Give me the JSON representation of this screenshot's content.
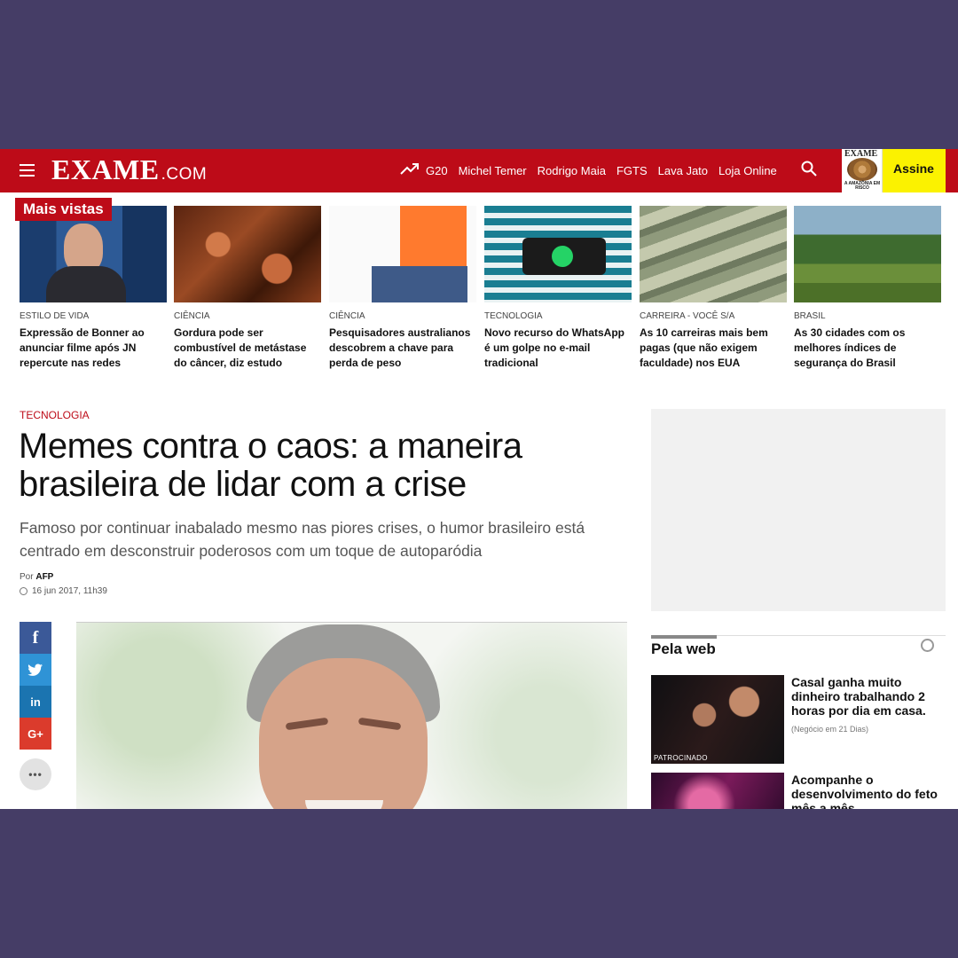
{
  "header": {
    "logo_main": "EXAME",
    "logo_suffix": ".COM",
    "nav": [
      "G20",
      "Michel Temer",
      "Rodrigo Maia",
      "FGTS",
      "Lava Jato",
      "Loja Online"
    ],
    "subscribe_label": "Assine",
    "cover_title": "EXAME",
    "cover_caption": "A AMAZÔNIA EM RISCO"
  },
  "most_viewed": {
    "label": "Mais vistas",
    "items": [
      {
        "category": "ESTILO DE VIDA",
        "title": "Expressão de Bonner ao anunciar filme após JN repercute nas redes"
      },
      {
        "category": "CIÊNCIA",
        "title": "Gordura pode ser combustível de metástase do câncer, diz estudo"
      },
      {
        "category": "CIÊNCIA",
        "title": "Pesquisadores australianos descobrem a chave para perda de peso"
      },
      {
        "category": "TECNOLOGIA",
        "title": "Novo recurso do WhatsApp é um golpe no e-mail tradicional"
      },
      {
        "category": "CARREIRA - VOCÊ S/A",
        "title": "As 10 carreiras mais bem pagas (que não exigem faculdade) nos EUA"
      },
      {
        "category": "BRASIL",
        "title": "As 30 cidades com os melhores índices de segurança do Brasil"
      }
    ]
  },
  "article": {
    "category": "TECNOLOGIA",
    "title": "Memes contra o caos: a maneira brasileira de lidar com a crise",
    "lead": "Famoso por continuar inabalado mesmo nas piores crises, o humor brasileiro está centrado em desconstruir poderosos com um toque de autoparódia",
    "by_prefix": "Por",
    "author": "AFP",
    "date": "16 jun 2017, 11h39"
  },
  "share": {
    "facebook": "f",
    "twitter": "🐦",
    "linkedin": "in",
    "googleplus": "G+",
    "more": "•••"
  },
  "pela_web": {
    "heading": "Pela web",
    "items": [
      {
        "title": "Casal ganha muito dinheiro trabalhando 2 horas por dia em casa.",
        "source": "(Negócio em 21 Dias)",
        "tag": "PATROCINADO"
      },
      {
        "title": "Acompanhe o desenvolvimento do feto mês a mês"
      }
    ]
  },
  "colors": {
    "brand_red": "#bd0b18",
    "subscribe_yellow": "#fbf200",
    "backdrop": "#453d66"
  }
}
